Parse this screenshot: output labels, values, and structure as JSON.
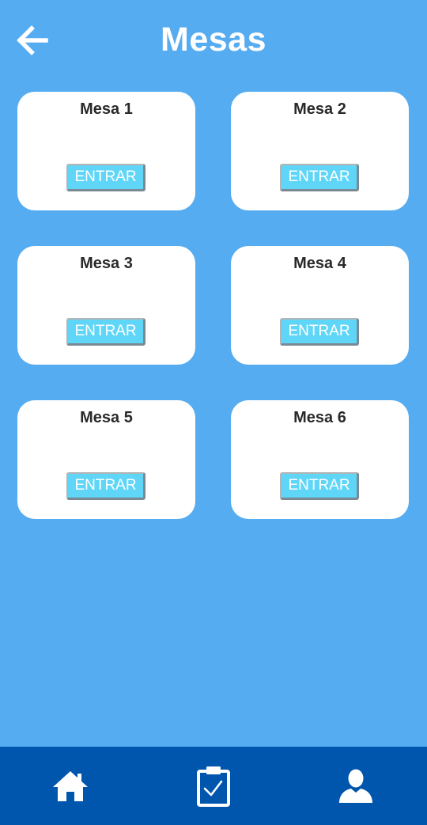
{
  "header": {
    "title": "Mesas",
    "back_icon": "arrow-left-icon"
  },
  "tables": [
    {
      "name": "Mesa 1",
      "button_label": "ENTRAR"
    },
    {
      "name": "Mesa 2",
      "button_label": "ENTRAR"
    },
    {
      "name": "Mesa 3",
      "button_label": "ENTRAR"
    },
    {
      "name": "Mesa 4",
      "button_label": "ENTRAR"
    },
    {
      "name": "Mesa 5",
      "button_label": "ENTRAR"
    },
    {
      "name": "Mesa 6",
      "button_label": "ENTRAR"
    }
  ],
  "bottom_nav": {
    "items": [
      {
        "icon": "home-icon"
      },
      {
        "icon": "clipboard-check-icon"
      },
      {
        "icon": "user-icon"
      }
    ]
  },
  "colors": {
    "background": "#56acf0",
    "card": "#ffffff",
    "button": "#5fd6f8",
    "bottom_nav": "#0055ad"
  }
}
